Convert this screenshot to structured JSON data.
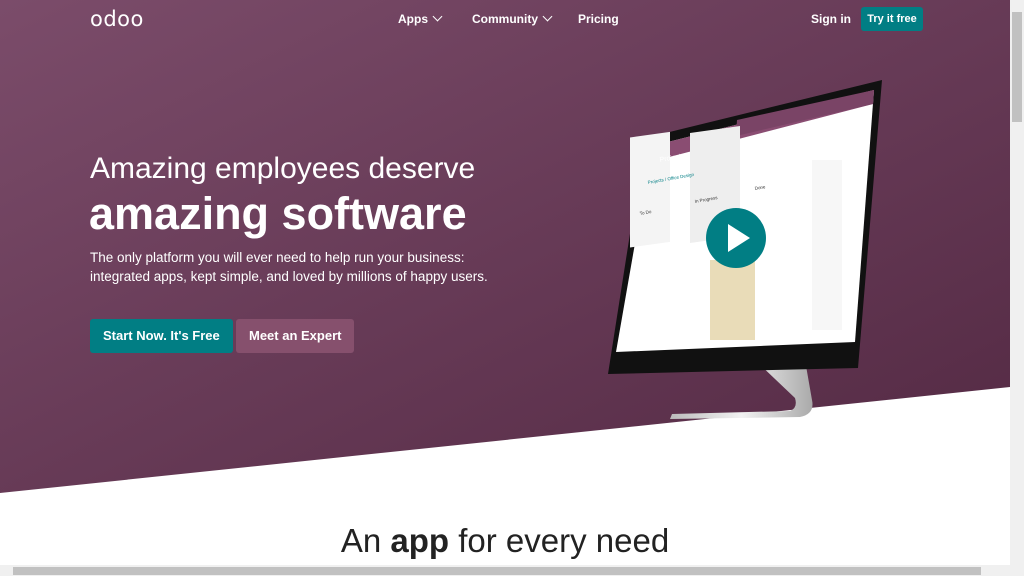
{
  "nav": {
    "logo": "odoo",
    "apps": "Apps",
    "community": "Community",
    "pricing": "Pricing",
    "sign_in": "Sign in",
    "try_free": "Try it free"
  },
  "hero": {
    "title_line1": "Amazing employees deserve",
    "title_line2": "amazing software",
    "subtitle_line1": "The only platform you will ever need to help run your business:",
    "subtitle_line2": "integrated apps, kept simple, and loved by millions of happy users.",
    "start_button": "Start Now. It's Free",
    "expert_button": "Meet an Expert"
  },
  "screen": {
    "app": "Project",
    "breadcrumb": "Projects / Office Design",
    "col_todo": "To Do",
    "col_progress": "In Progress",
    "col_done": "Done"
  },
  "section": {
    "heading_pre": "An ",
    "heading_bold": "app",
    "heading_post": " for every need"
  },
  "colors": {
    "brand": "#714b67",
    "accent": "#017e84"
  }
}
